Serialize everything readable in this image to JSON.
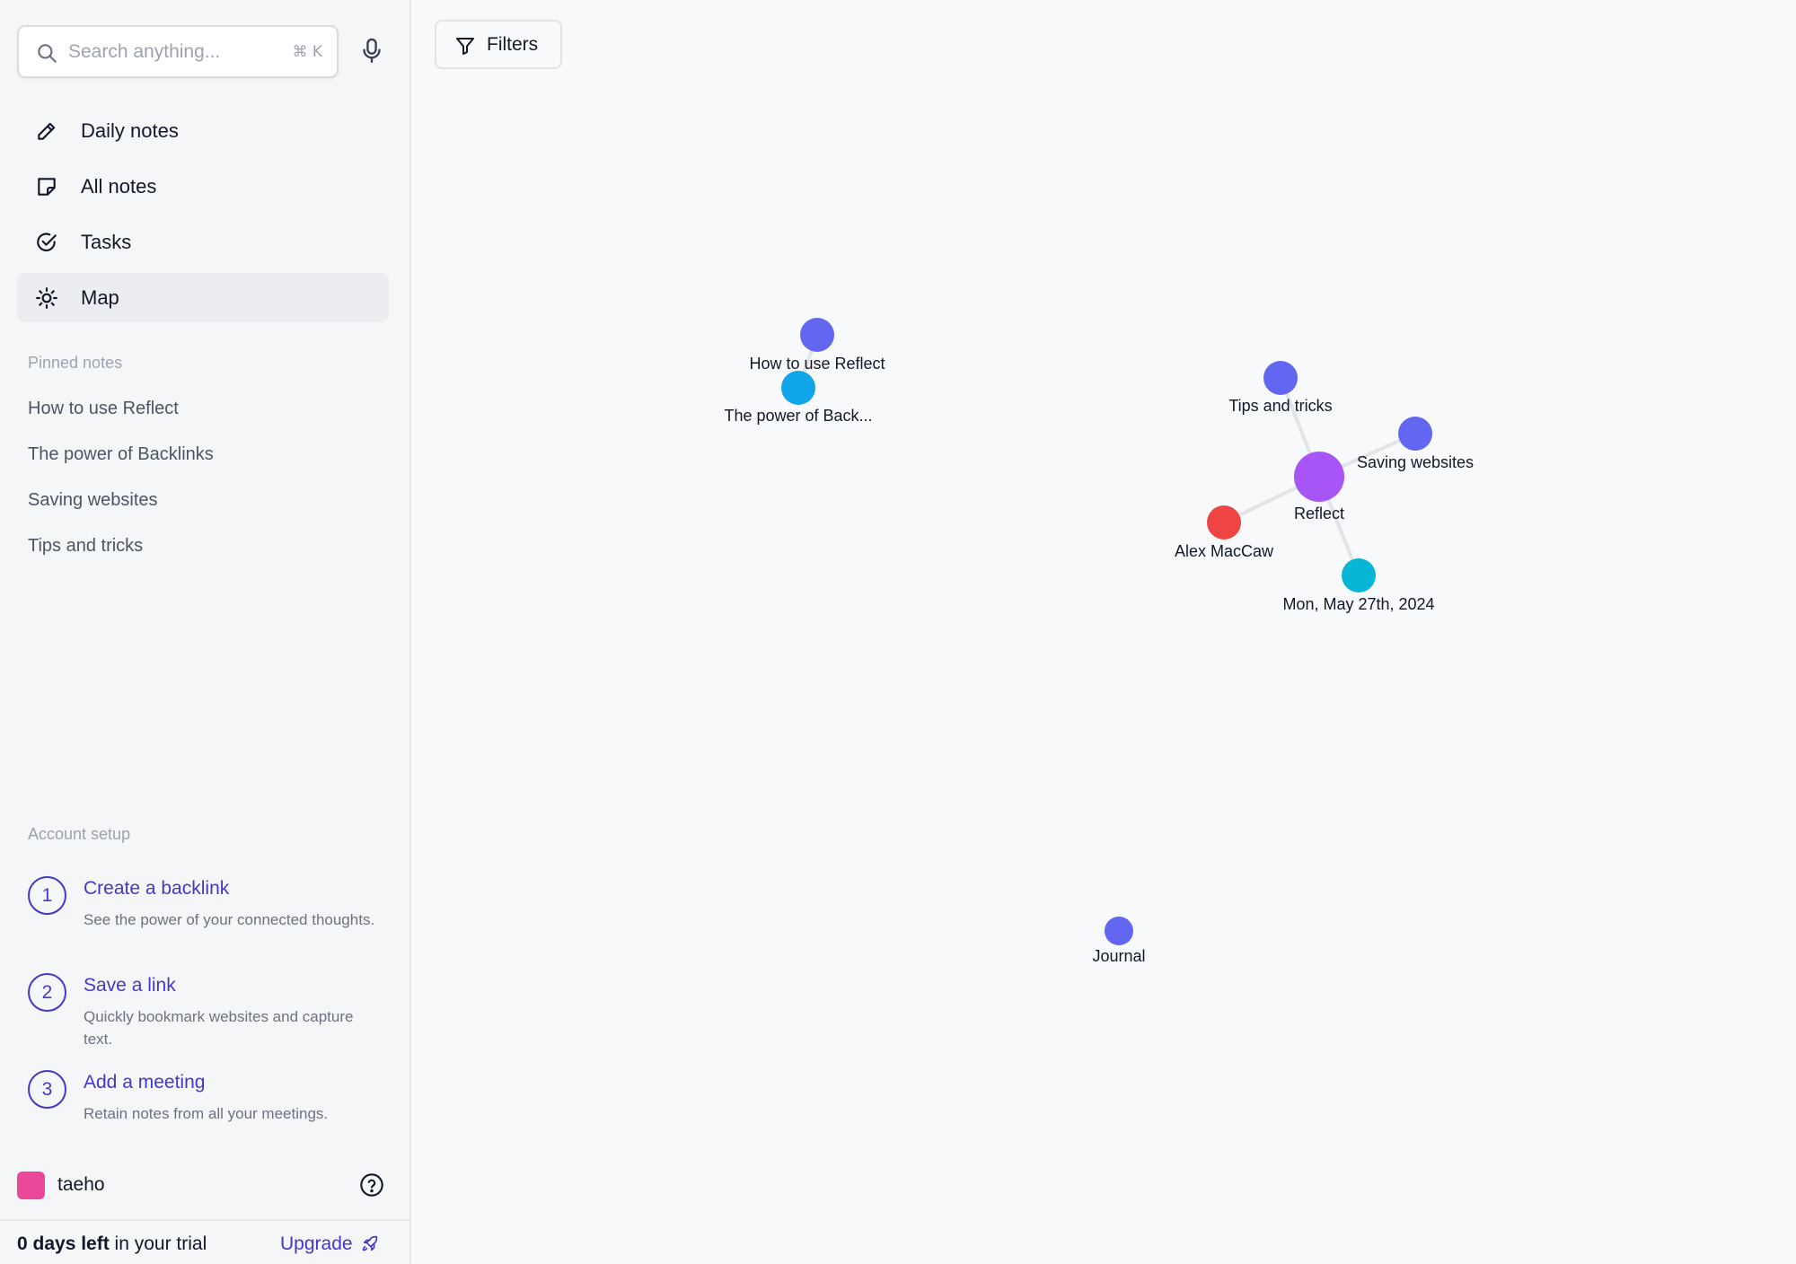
{
  "search": {
    "placeholder": "Search anything...",
    "shortcut": "⌘ K"
  },
  "nav": [
    {
      "label": "Daily notes",
      "icon": "pencil-icon"
    },
    {
      "label": "All notes",
      "icon": "note-icon"
    },
    {
      "label": "Tasks",
      "icon": "check-circle-icon"
    },
    {
      "label": "Map",
      "icon": "sun-icon",
      "active": true
    }
  ],
  "pinned": {
    "title": "Pinned notes",
    "items": [
      "How to use Reflect",
      "The power of Backlinks",
      "Saving websites",
      "Tips and tricks"
    ]
  },
  "setup": {
    "title": "Account setup",
    "steps": [
      {
        "num": "1",
        "title": "Create a backlink",
        "desc": "See the power of your connected thoughts."
      },
      {
        "num": "2",
        "title": "Save a link",
        "desc": "Quickly bookmark websites and capture text."
      },
      {
        "num": "3",
        "title": "Add a meeting",
        "desc": "Retain notes from all your meetings."
      }
    ]
  },
  "user": {
    "name": "taeho",
    "avatar_color": "#ec4899"
  },
  "trial": {
    "days": "0 days left",
    "suffix": " in your trial",
    "upgrade": "Upgrade"
  },
  "filters": {
    "label": "Filters"
  },
  "graph": {
    "nodes": [
      {
        "id": "how-to-use",
        "label": "How to use Reflect",
        "color": "#6366f1"
      },
      {
        "id": "power-backlinks",
        "label": "The power of Back...",
        "color": "#0ea5e9"
      },
      {
        "id": "tips",
        "label": "Tips and tricks",
        "color": "#6366f1"
      },
      {
        "id": "saving",
        "label": "Saving websites",
        "color": "#6366f1"
      },
      {
        "id": "reflect",
        "label": "Reflect",
        "color": "#a855f7"
      },
      {
        "id": "alex",
        "label": "Alex MacCaw",
        "color": "#ef4444"
      },
      {
        "id": "may27",
        "label": "Mon, May 27th, 2024",
        "color": "#06b6d4"
      },
      {
        "id": "journal",
        "label": "Journal",
        "color": "#6366f1"
      }
    ],
    "edges": [
      [
        "how-to-use",
        "power-backlinks"
      ],
      [
        "reflect",
        "tips"
      ],
      [
        "reflect",
        "saving"
      ],
      [
        "reflect",
        "alex"
      ],
      [
        "reflect",
        "may27"
      ]
    ]
  }
}
